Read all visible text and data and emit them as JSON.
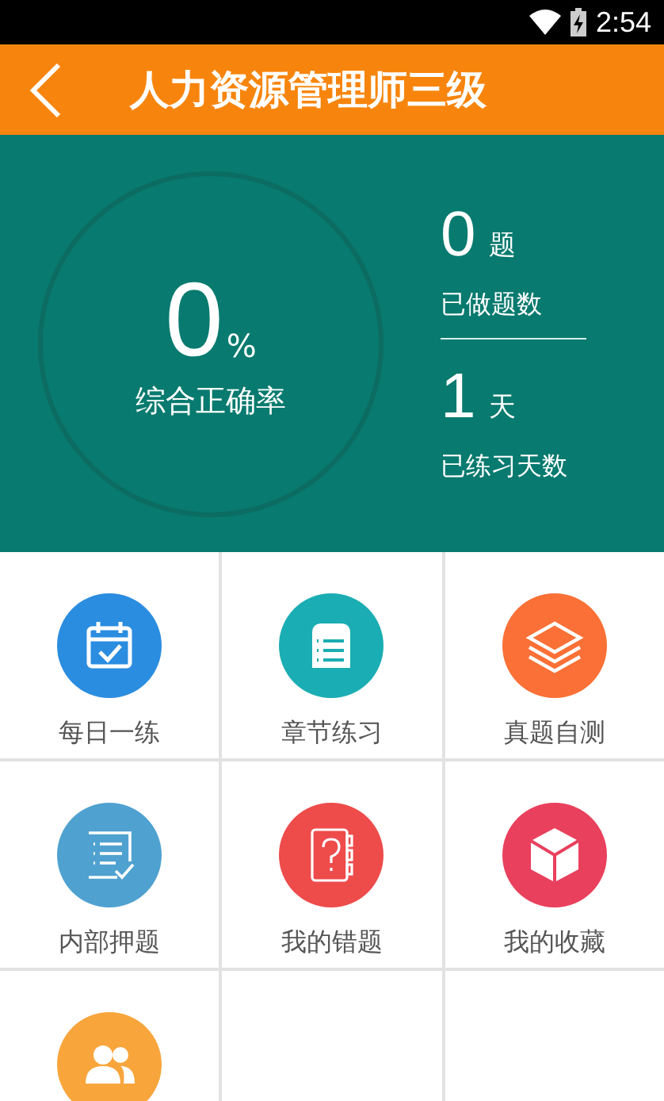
{
  "status_bar": {
    "time": "2:54"
  },
  "header": {
    "title": "人力资源管理师三级"
  },
  "summary": {
    "accuracy": {
      "value": "0",
      "unit": "%",
      "label": "综合正确率"
    },
    "stats": [
      {
        "value": "0",
        "unit": "题",
        "label": "已做题数"
      },
      {
        "value": "1",
        "unit": "天",
        "label": "已练习天数"
      }
    ]
  },
  "menu": [
    {
      "kind": "calendar",
      "label": "每日一练",
      "color": "#2b8de0"
    },
    {
      "kind": "list",
      "label": "章节练习",
      "color": "#1aadb3"
    },
    {
      "kind": "layers",
      "label": "真题自测",
      "color": "#fa7036"
    },
    {
      "kind": "checklist",
      "label": "内部押题",
      "color": "#4fa1d0"
    },
    {
      "kind": "notebook",
      "label": "我的错题",
      "color": "#ee4b4b"
    },
    {
      "kind": "cube",
      "label": "我的收藏",
      "color": "#e9405d"
    },
    {
      "kind": "people",
      "color": "#f8a53c"
    }
  ]
}
